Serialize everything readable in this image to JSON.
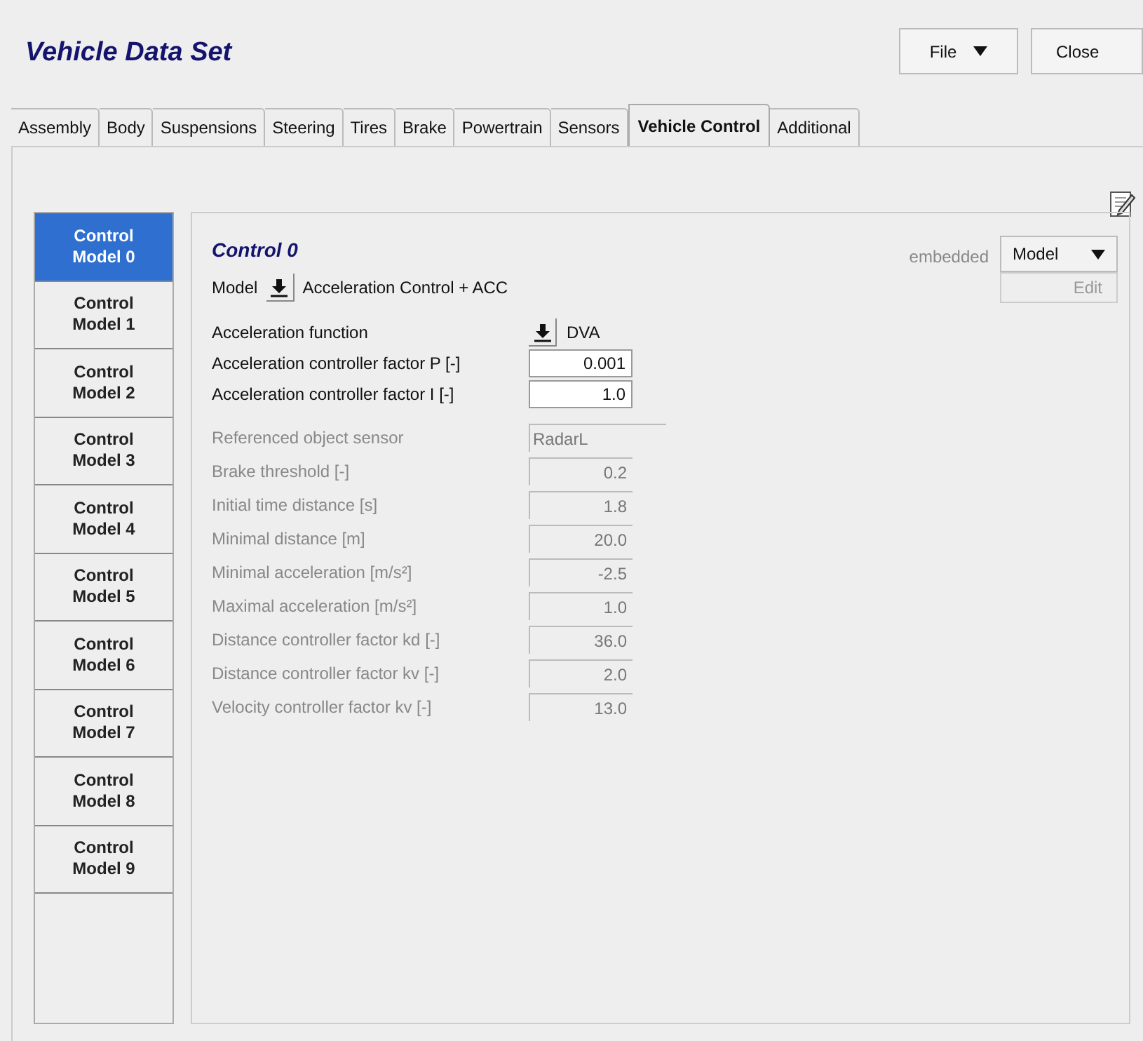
{
  "window": {
    "title": "Vehicle Data Set"
  },
  "header_buttons": [
    {
      "label": "File",
      "kind": "menu"
    },
    {
      "label": "Close",
      "kind": "button"
    }
  ],
  "tabs": [
    {
      "label": "Assembly",
      "selected": false
    },
    {
      "label": "Body",
      "selected": false
    },
    {
      "label": "Suspensions",
      "selected": false
    },
    {
      "label": "Steering",
      "selected": false
    },
    {
      "label": "Tires",
      "selected": false
    },
    {
      "label": "Brake",
      "selected": false
    },
    {
      "label": "Powertrain",
      "selected": false
    },
    {
      "label": "Sensors",
      "selected": false
    },
    {
      "label": "Vehicle Control",
      "selected": true
    },
    {
      "label": "Additional",
      "selected": false
    }
  ],
  "model_tabs": [
    {
      "label": "Control Model 0",
      "selected": true
    },
    {
      "label": "Control Model 1",
      "selected": false
    },
    {
      "label": "Control Model 2",
      "selected": false
    },
    {
      "label": "Control Model 3",
      "selected": false
    },
    {
      "label": "Control Model 4",
      "selected": false
    },
    {
      "label": "Control Model 5",
      "selected": false
    },
    {
      "label": "Control Model 6",
      "selected": false
    },
    {
      "label": "Control Model 7",
      "selected": false
    },
    {
      "label": "Control Model 8",
      "selected": false
    },
    {
      "label": "Control Model 9",
      "selected": false
    }
  ],
  "panel": {
    "title": "Control 0",
    "source": "embedded",
    "model_button": "Model",
    "edit_button": {
      "label": "Edit",
      "disabled": true
    },
    "model_row": {
      "label": "Model",
      "value": "Acceleration Control + ACC"
    }
  },
  "params": [
    {
      "label": "Acceleration function",
      "value": "DVA",
      "kind": "select",
      "disabled": false
    },
    {
      "label": "Acceleration controller factor P [-]",
      "value": "0.001",
      "kind": "number",
      "disabled": false
    },
    {
      "label": "Acceleration controller factor I [-]",
      "value": "1.0",
      "kind": "number",
      "disabled": false
    },
    {
      "label": "Referenced object sensor",
      "value": "RadarL",
      "kind": "text",
      "disabled": true
    },
    {
      "label": "Brake threshold [-]",
      "value": "0.2",
      "kind": "number",
      "disabled": true
    },
    {
      "label": "Initial time distance [s]",
      "value": "1.8",
      "kind": "number",
      "disabled": true
    },
    {
      "label": "Minimal distance [m]",
      "value": "20.0",
      "kind": "number",
      "disabled": true
    },
    {
      "label": "Minimal acceleration [m/s²]",
      "value": "-2.5",
      "kind": "number",
      "disabled": true
    },
    {
      "label": "Maximal acceleration [m/s²]",
      "value": "1.0",
      "kind": "number",
      "disabled": true
    },
    {
      "label": "Distance controller factor kd [-]",
      "value": "36.0",
      "kind": "number",
      "disabled": true
    },
    {
      "label": "Distance controller factor kv [-]",
      "value": "2.0",
      "kind": "number",
      "disabled": true
    },
    {
      "label": "Velocity controller factor kv [-]",
      "value": "13.0",
      "kind": "number",
      "disabled": true
    }
  ]
}
